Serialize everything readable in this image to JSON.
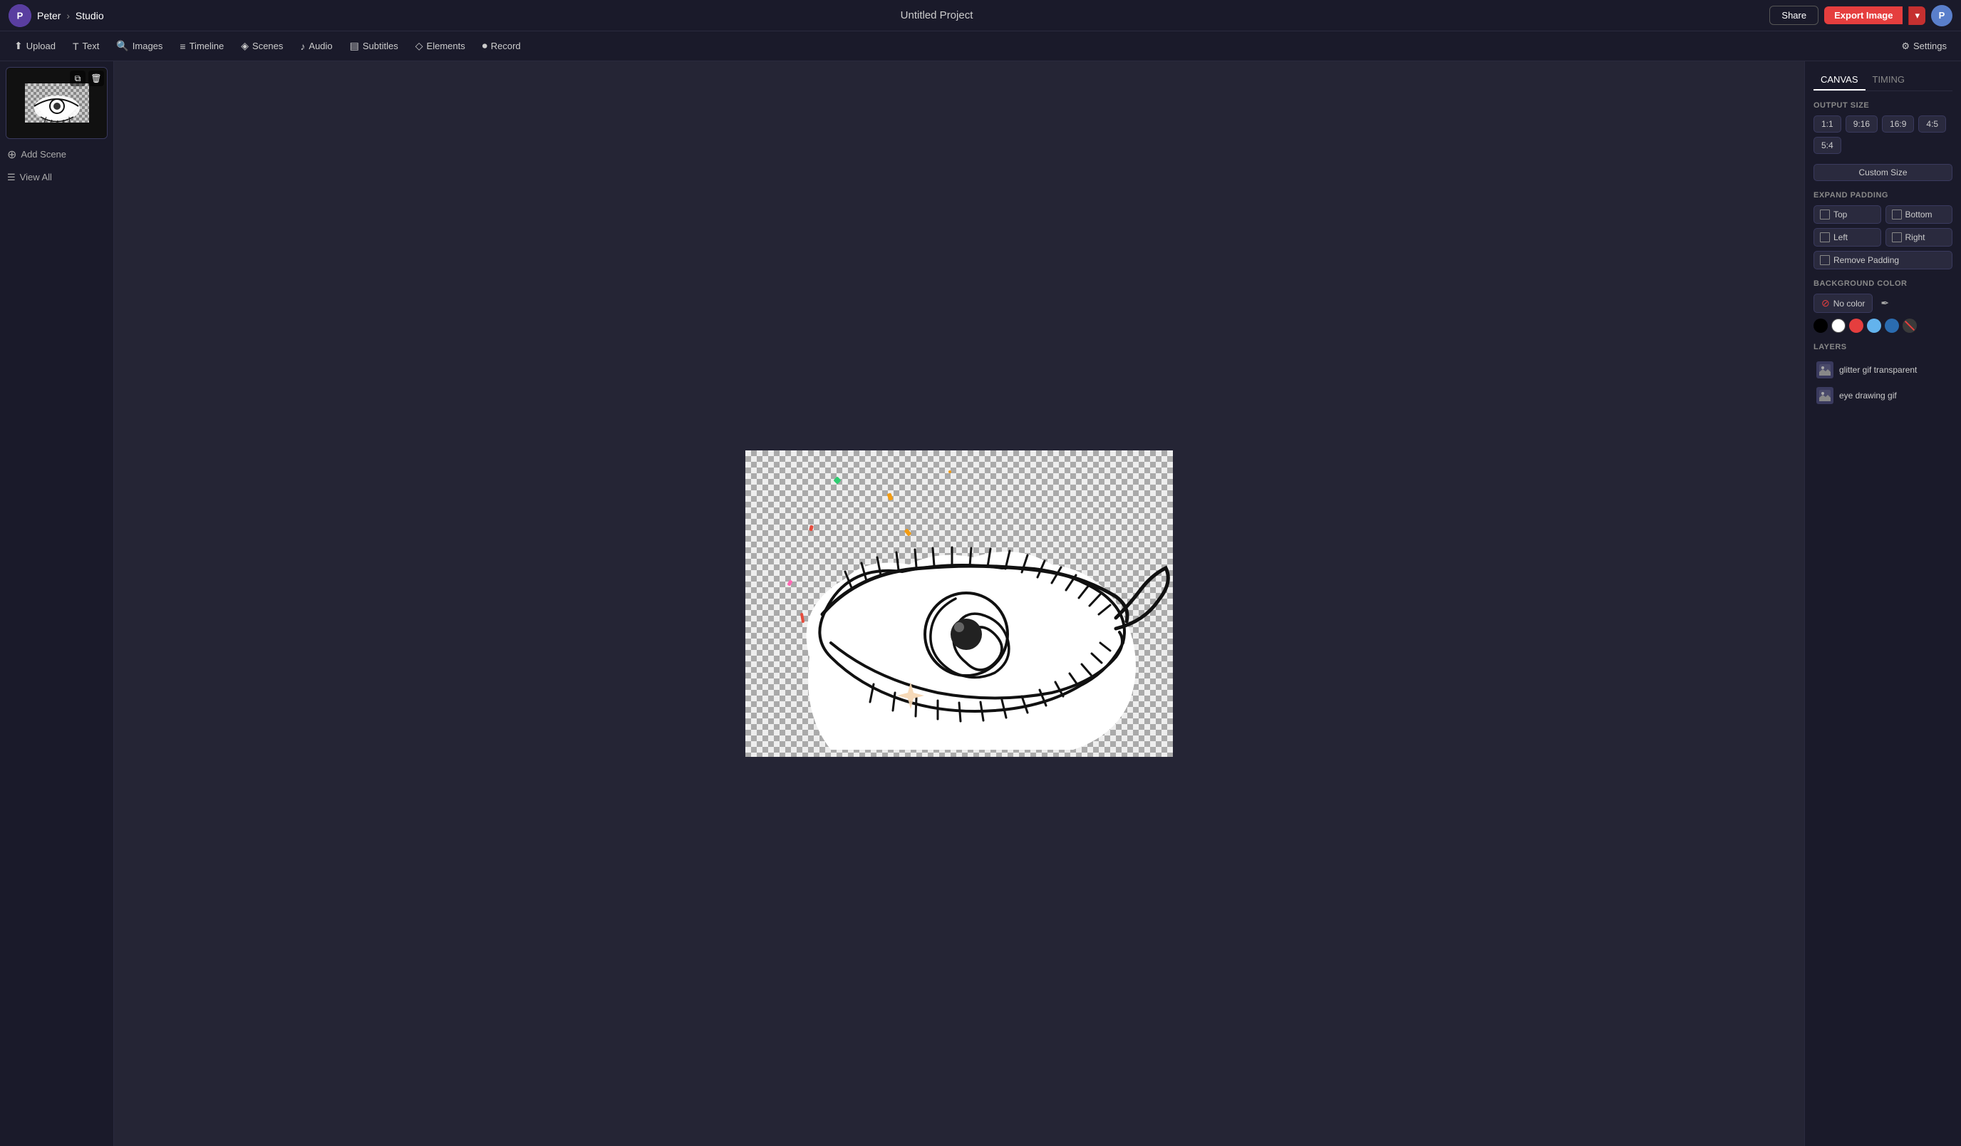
{
  "topbar": {
    "user_name": "Peter",
    "breadcrumb_sep": "›",
    "studio_label": "Studio",
    "project_title": "Untitled Project",
    "share_label": "Share",
    "export_label": "Export Image",
    "user_initial": "P"
  },
  "toolbar": {
    "items": [
      {
        "id": "upload",
        "icon": "⬆",
        "label": "Upload"
      },
      {
        "id": "text",
        "icon": "T",
        "label": "Text"
      },
      {
        "id": "images",
        "icon": "🔍",
        "label": "Images"
      },
      {
        "id": "timeline",
        "icon": "≡",
        "label": "Timeline"
      },
      {
        "id": "scenes",
        "icon": "◈",
        "label": "Scenes"
      },
      {
        "id": "audio",
        "icon": "♪",
        "label": "Audio"
      },
      {
        "id": "subtitles",
        "icon": "▤",
        "label": "Subtitles"
      },
      {
        "id": "elements",
        "icon": "◇",
        "label": "Elements"
      },
      {
        "id": "record",
        "icon": "⏺",
        "label": "Record"
      }
    ],
    "settings_label": "Settings"
  },
  "sidebar": {
    "add_scene_label": "Add Scene",
    "view_all_label": "View All"
  },
  "right_panel": {
    "tabs": [
      {
        "id": "canvas",
        "label": "CANVAS"
      },
      {
        "id": "timing",
        "label": "TIMING"
      }
    ],
    "active_tab": "canvas",
    "output_size": {
      "label": "OUTPUT SIZE",
      "options": [
        "1:1",
        "9:16",
        "16:9",
        "4:5",
        "5:4"
      ],
      "custom_label": "Custom Size"
    },
    "expand_padding": {
      "label": "EXPAND PADDING",
      "top_label": "Top",
      "bottom_label": "Bottom",
      "left_label": "Left",
      "right_label": "Right",
      "remove_label": "Remove Padding"
    },
    "background_color": {
      "label": "BACKGROUND COLOR",
      "no_color_label": "No color",
      "swatches": [
        {
          "id": "black",
          "color": "#000000"
        },
        {
          "id": "white",
          "color": "#ffffff"
        },
        {
          "id": "red",
          "color": "#e53e3e"
        },
        {
          "id": "blue-light",
          "color": "#63b3ed"
        },
        {
          "id": "blue-dark",
          "color": "#2b6cb0"
        },
        {
          "id": "no-color",
          "color": "none"
        }
      ]
    },
    "layers": {
      "label": "LAYERS",
      "items": [
        {
          "id": "layer1",
          "name": "glitter gif transparent"
        },
        {
          "id": "layer2",
          "name": "eye drawing gif"
        }
      ]
    }
  }
}
